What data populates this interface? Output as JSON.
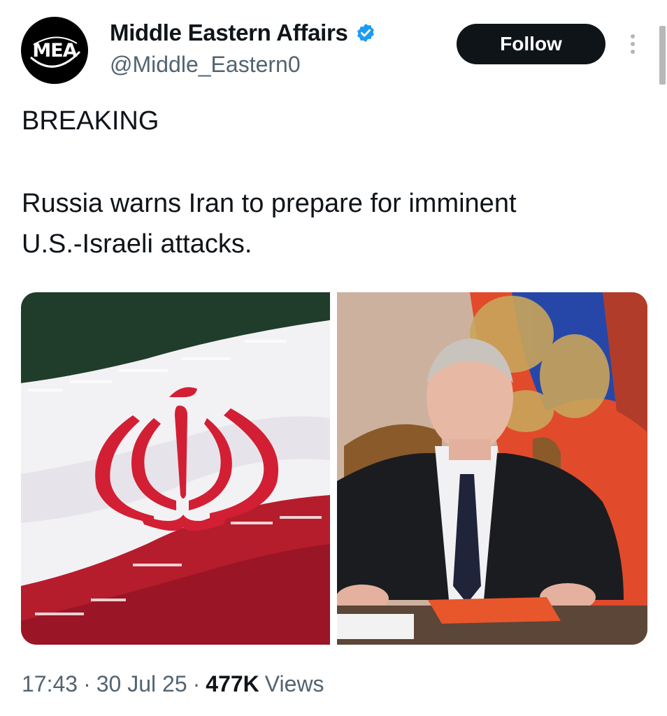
{
  "account": {
    "avatar_text": "MEA",
    "display_name": "Middle Eastern Affairs",
    "handle": "@Middle_Eastern0",
    "verified": true
  },
  "header": {
    "follow_label": "Follow",
    "more_icon": "more-vertical-icon"
  },
  "tweet": {
    "lines": [
      "BREAKING",
      "Russia warns Iran to prepare for imminent",
      "U.S.-Israeli attacks."
    ]
  },
  "media": {
    "images": [
      {
        "label": "iran-flag-photo"
      },
      {
        "label": "putin-photo"
      }
    ]
  },
  "meta": {
    "time": "17:43",
    "separator": "·",
    "date": "30 Jul 25",
    "views_count": "477K",
    "views_label": "Views"
  },
  "colors": {
    "follow_bg": "#0f1419",
    "secondary_text": "#536471",
    "verified_blue": "#1d9bf0",
    "flag_red": "#d21f34",
    "flag_green": "#1f3d2a"
  }
}
